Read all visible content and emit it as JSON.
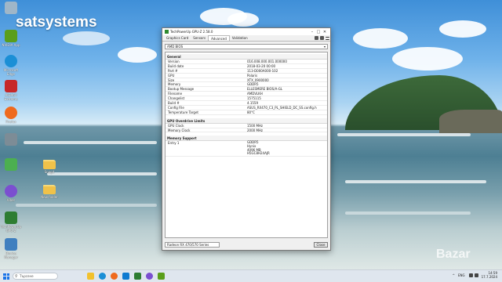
{
  "brand": {
    "name": "satsystems"
  },
  "desktop_icons": [
    {
      "label": ""
    },
    {
      "label": "NVIDIA App"
    },
    {
      "label": "Microsoft Edge"
    },
    {
      "label": "AIDA64 Extreme"
    },
    {
      "label": "Firefox"
    },
    {
      "label": ""
    },
    {
      "label": ""
    },
    {
      "label": "Viber"
    },
    {
      "label": "TechPowerUp GPU-Z"
    },
    {
      "label": "Device Manager"
    }
  ],
  "desktop_folders": [
    {
      "label": "Snagit"
    },
    {
      "label": "New folder"
    }
  ],
  "window": {
    "title": "TechPowerUp GPU-Z 2.58.0",
    "tabs": [
      {
        "label": "Graphics Card"
      },
      {
        "label": "Sensors"
      },
      {
        "label": "Advanced"
      },
      {
        "label": "Validation"
      }
    ],
    "category_select": "AMD BIOS",
    "sections": {
      "general": {
        "title": "General",
        "rows": [
          {
            "key": "Version",
            "value": "016.008.000.001.000000"
          },
          {
            "key": "Build date",
            "value": "2018-03-20 00:00"
          },
          {
            "key": "Part #",
            "value": "113-D000A000-102"
          },
          {
            "key": "GPU",
            "value": "Polaris"
          },
          {
            "key": "Size",
            "value": "XTX_0900000"
          },
          {
            "key": "Memory",
            "value": "GDDR5"
          },
          {
            "key": "Bootup Message",
            "value": "ELLESMERE BIOS/A-GL"
          },
          {
            "key": "Filename",
            "value": "AMDVLKH"
          },
          {
            "key": "Changelist",
            "value": "1575115"
          },
          {
            "key": "Build #",
            "value": "4.1559"
          },
          {
            "key": "Config File",
            "value": "ASUS_RX470_C3_PL_SHIELD_DC_SS.config.h"
          },
          {
            "key": "Temperature Target",
            "value": "80°C"
          }
        ]
      },
      "overdrive": {
        "title": "GPU Overdrive Limits",
        "rows": [
          {
            "key": "GPU Clock",
            "value": "1500 MHz"
          },
          {
            "key": "Memory Clock",
            "value": "2000 MHz"
          }
        ]
      },
      "memory": {
        "title": "Memory Support",
        "rows": [
          {
            "key": "Entry 1",
            "lines": [
              "GDDR5",
              "Hynix",
              "4096 MB",
              "H5GC8H24AJR"
            ]
          }
        ]
      }
    },
    "footer": {
      "device_select": "Radeon RX 470/570 Series",
      "close_label": "Close"
    }
  },
  "taskbar": {
    "search_placeholder": "Търсене",
    "language": "ENG",
    "time": "14:59",
    "date": "17.7.2024"
  },
  "watermark": "Bazar",
  "colors": {
    "accent": "#1a73e8",
    "window_bg": "#f0f0f0",
    "taskbar_bg": "#dfe6ee"
  }
}
